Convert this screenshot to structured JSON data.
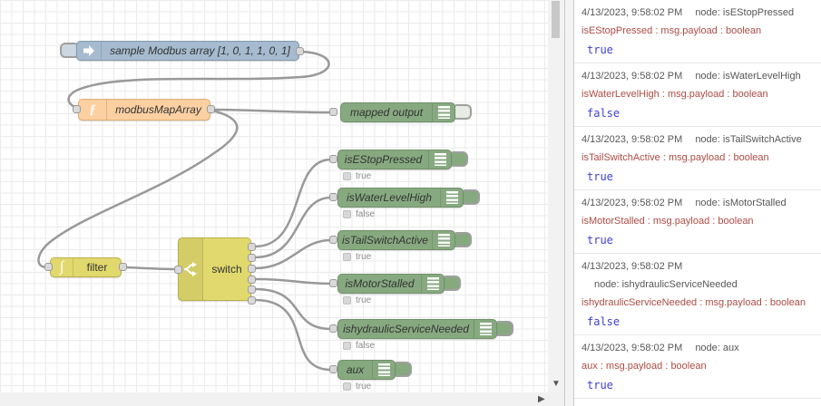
{
  "canvas": {
    "inject_node": {
      "label": "sample Modbus array [1, 0, 1, 1, 0, 1]"
    },
    "function_node": {
      "label": "modbusMapArray",
      "icon_glyph": "ƒ"
    },
    "mapped_output_node": {
      "label": "mapped output",
      "toggle": "off"
    },
    "filter_node": {
      "label": "filter",
      "icon_glyph": "∫"
    },
    "switch_node": {
      "label": "switch",
      "outputs": 6
    },
    "debug_nodes": [
      {
        "label": "isEStopPressed",
        "status": "true",
        "toggle": "on"
      },
      {
        "label": "isWaterLevelHigh",
        "status": "false",
        "toggle": "on"
      },
      {
        "label": "isTailSwitchActive",
        "status": "true",
        "toggle": "on"
      },
      {
        "label": "isMotorStalled",
        "status": "true",
        "toggle": "on"
      },
      {
        "label": "ishydraulicServiceNeeded",
        "status": "false",
        "toggle": "on"
      },
      {
        "label": "aux",
        "status": "true",
        "toggle": "on"
      }
    ]
  },
  "scrollbars": {
    "down_arrow": "▼",
    "right_arrow": "▶"
  },
  "sidebar": {
    "messages": [
      {
        "timestamp": "4/13/2023, 9:58:02 PM",
        "node_ref": "node: isEStopPressed",
        "path": "isEStopPressed : msg.payload : boolean",
        "value": "true"
      },
      {
        "timestamp": "4/13/2023, 9:58:02 PM",
        "node_ref": "node: isWaterLevelHigh",
        "path": "isWaterLevelHigh : msg.payload : boolean",
        "value": "false"
      },
      {
        "timestamp": "4/13/2023, 9:58:02 PM",
        "node_ref": "node: isTailSwitchActive",
        "path": "isTailSwitchActive : msg.payload : boolean",
        "value": "true"
      },
      {
        "timestamp": "4/13/2023, 9:58:02 PM",
        "node_ref": "node: isMotorStalled",
        "path": "isMotorStalled : msg.payload : boolean",
        "value": "true"
      },
      {
        "timestamp": "4/13/2023, 9:58:02 PM",
        "node_ref": "node: ishydraulicServiceNeeded",
        "path": "ishydraulicServiceNeeded : msg.payload : boolean",
        "value": "false"
      },
      {
        "timestamp": "4/13/2023, 9:58:02 PM",
        "node_ref": "node: aux",
        "path": "aux : msg.payload : boolean",
        "value": "true"
      }
    ]
  },
  "colors": {
    "inject_node": "#a6bbcf",
    "function_node": "#fdd0a2",
    "debug_node": "#87a980",
    "switch_filter_node": "#e2d96e",
    "wire": "#999999",
    "debug_path_text": "#ad4b44",
    "debug_value_text": "#3f3fd2"
  }
}
